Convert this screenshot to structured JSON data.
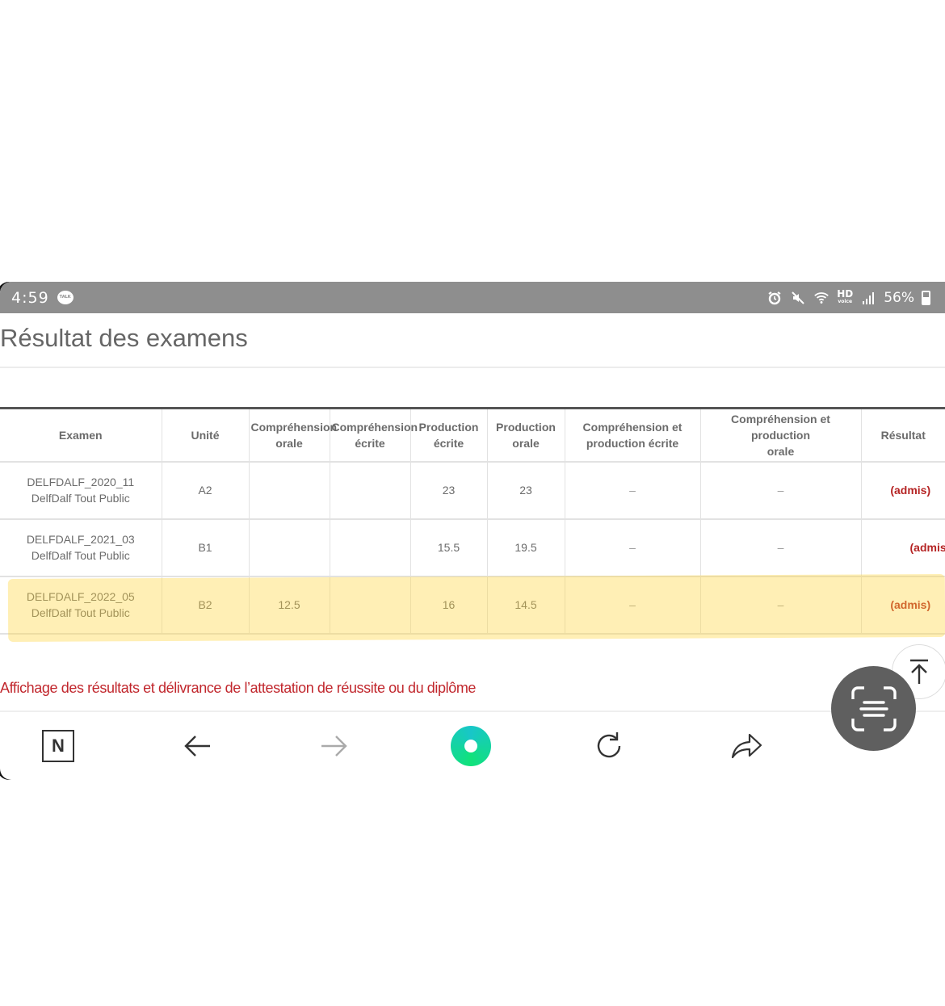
{
  "status_bar": {
    "time": "4:59",
    "hd_label": "HD",
    "hd_sub": "voice",
    "battery": "56%"
  },
  "page": {
    "title": "Résultat des examens"
  },
  "table": {
    "headers": [
      [
        "Examen"
      ],
      [
        "Unité"
      ],
      [
        "Compréhension",
        "orale"
      ],
      [
        "Compréhension",
        "écrite"
      ],
      [
        "Production",
        "écrite"
      ],
      [
        "Production",
        "orale"
      ],
      [
        "Compréhension et",
        "production écrite"
      ],
      [
        "Compréhension et production",
        "orale"
      ],
      [
        "Résultat"
      ]
    ],
    "rows": [
      {
        "exam_code": "DELFDALF_2020_11",
        "exam_type": "DelfDalf Tout Public",
        "unit": "A2",
        "comp_orale": "",
        "comp_ecrite": "",
        "prod_ecrite": "23",
        "prod_orale": "23",
        "comp_prod_ecrite": "–",
        "comp_prod_orale": "–",
        "result": "(admis)"
      },
      {
        "exam_code": "DELFDALF_2021_03",
        "exam_type": "DelfDalf Tout Public",
        "unit": "B1",
        "comp_orale": "",
        "comp_ecrite": "",
        "prod_ecrite": "15.5",
        "prod_orale": "19.5",
        "comp_prod_ecrite": "–",
        "comp_prod_orale": "–",
        "result": "(admis)"
      },
      {
        "exam_code": "DELFDALF_2022_05",
        "exam_type": "DelfDalf Tout Public",
        "unit": "B2",
        "comp_orale": "12.5",
        "comp_ecrite": "",
        "prod_ecrite": "16",
        "prod_orale": "14.5",
        "comp_prod_ecrite": "–",
        "comp_prod_orale": "–",
        "result": "(admis)"
      }
    ]
  },
  "footer": {
    "link_text": "Affichage des résultats et délivrance de l’attestation de réussite ou du diplôme"
  },
  "navbar": {
    "n_label": "N"
  },
  "colors": {
    "status_bar_bg": "#8e8e8e",
    "result_red": "#b52424",
    "link_red": "#c1272d",
    "highlight_yellow": "#ffd63c"
  }
}
